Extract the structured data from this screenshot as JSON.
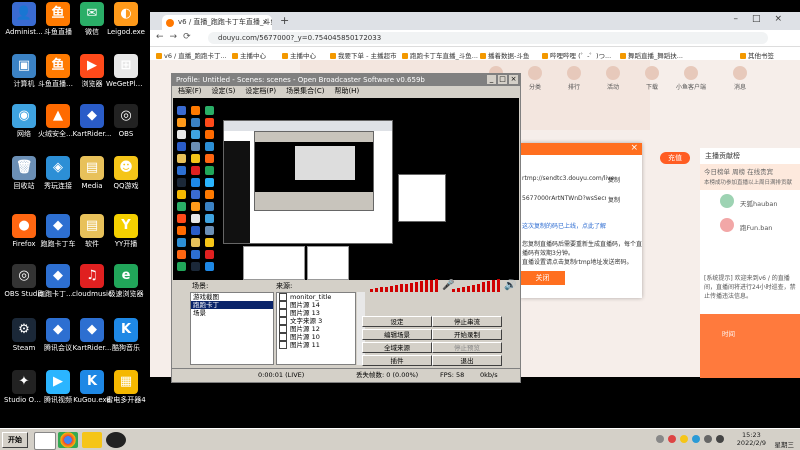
{
  "desktop": {
    "icons": [
      {
        "label": "Administ...",
        "color": "#3a6bd1",
        "glyph": "👤"
      },
      {
        "label": "斗鱼直播",
        "color": "#ff7a00",
        "glyph": "鱼"
      },
      {
        "label": "微信",
        "color": "#2aae67",
        "glyph": "✉"
      },
      {
        "label": "Leigod.exe",
        "color": "#ff9a1a",
        "glyph": "◐"
      },
      {
        "label": "计算机",
        "color": "#3b82c4",
        "glyph": "▣"
      },
      {
        "label": "斗鱼直播伴侣",
        "color": "#ff7a00",
        "glyph": "鱼"
      },
      {
        "label": "浏览器",
        "color": "#ff4a1a",
        "glyph": "▶"
      },
      {
        "label": "WeGetPlug...",
        "color": "#e8e8e8",
        "glyph": "⊞"
      },
      {
        "label": "网络",
        "color": "#3fa3e0",
        "glyph": "◉"
      },
      {
        "label": "火绒安全软件",
        "color": "#ff6a00",
        "glyph": "▲"
      },
      {
        "label": "KartRider...",
        "color": "#2a5cc8",
        "glyph": "◆"
      },
      {
        "label": "OBS",
        "color": "#222222",
        "glyph": "◎"
      },
      {
        "label": "回收站",
        "color": "#6b8fb5",
        "glyph": "🗑"
      },
      {
        "label": "秀玩连接",
        "color": "#2c8fd6",
        "glyph": "◈"
      },
      {
        "label": "Media",
        "color": "#e8c15a",
        "glyph": "▤"
      },
      {
        "label": "QQ游戏",
        "color": "#f5c518",
        "glyph": "☻"
      },
      {
        "label": "Firefox",
        "color": "#ff6611",
        "glyph": "●"
      },
      {
        "label": "跑跑卡丁车",
        "color": "#2d6fd1",
        "glyph": "◆"
      },
      {
        "label": "软件",
        "color": "#e8c15a",
        "glyph": "▤"
      },
      {
        "label": "YY开播",
        "color": "#f5d000",
        "glyph": "Y"
      },
      {
        "label": "OBS Studio",
        "color": "#333333",
        "glyph": "◎"
      },
      {
        "label": "跑跑卡丁车插件",
        "color": "#2d6fd1",
        "glyph": "◆"
      },
      {
        "label": "cloudmusic",
        "color": "#e02020",
        "glyph": "♫"
      },
      {
        "label": "极速浏览器",
        "color": "#21a65a",
        "glyph": "e"
      },
      {
        "label": "Steam",
        "color": "#1b2838",
        "glyph": "⚙"
      },
      {
        "label": "腾讯会议",
        "color": "#2d6fd1",
        "glyph": "◆"
      },
      {
        "label": "KartRider...",
        "color": "#2d6fd1",
        "glyph": "◆"
      },
      {
        "label": "酷狗音乐",
        "color": "#1e88e5",
        "glyph": "K"
      },
      {
        "label": "Studio One 3",
        "color": "#222222",
        "glyph": "✦"
      },
      {
        "label": "腾讯视频",
        "color": "#2bb5ff",
        "glyph": "▶"
      },
      {
        "label": "KuGou.exe",
        "color": "#1e88e5",
        "glyph": "K"
      },
      {
        "label": "雷电多开器4",
        "color": "#f5b800",
        "glyph": "▦"
      }
    ]
  },
  "browser": {
    "tab_title": "v6 / 直播_跑跑卡丁车直播_斗鱼直播",
    "url": "douyu.com/5677000?_y=0.754045850172033",
    "bookmarks": [
      "v6 / 直播_跑跑卡丁...",
      "主播中心",
      "主播中心",
      "我要下单 - 主播超市",
      "跑跑卡丁车直播_斗鱼...",
      "播着数据-斗鱼",
      "哔哩哔哩 (゜-゜)つ...",
      "舞蹈直播_舞蹈扶...",
      "其他书签"
    ],
    "nav_items": [
      "鱼吧",
      "分类",
      "排行",
      "活动",
      "下载",
      "小鱼客户端",
      "消息"
    ],
    "red_button": "充值",
    "dialog": {
      "lines": [
        "rtmp://sendtc3.douyu.com/live",
        "5677000rArtNTWnD?wsSecret=********",
        "这次复制的码已上线，点此了解",
        "您复制直播码后需要重新生成直播码，每个直",
        "播码有效期3分钟。",
        "直播设置请点击复制rtmp地址发送密码。"
      ],
      "copy_label": "复制",
      "close_label": "关闭"
    },
    "side_panel": {
      "header": "主播贡献榜",
      "tabs_text": "今日榜单   周榜   在线贵宾",
      "banner": "本榜成功参加直播以上周日满排贡献",
      "users": [
        "天狐hauban",
        "跑Fun.ban"
      ],
      "notice": "[系统提示] 欢迎来到v6 / 的直播间，直播间将进行24小时巡查，禁止传播违法信息。",
      "promo_text": "时间"
    }
  },
  "obs": {
    "title": "Profile: Untitled - Scenes: scenes - Open Broadcaster Software v0.659b",
    "menu": [
      "档案(F)",
      "设定(S)",
      "设定档(P)",
      "场景集合(C)",
      "帮助(H)"
    ],
    "scenes_label": "场景:",
    "sources_label": "来源:",
    "scenes": [
      "游戏截图",
      "跑跑卡丁",
      "场景"
    ],
    "sources": [
      "monitor_title",
      "图片源 14",
      "图片源 13",
      "文字来源 3",
      "图片源 12",
      "图片源 10",
      "图片源 11"
    ],
    "buttons": {
      "settings": "设定",
      "stop_stream": "停止串流",
      "edit_scene": "编辑场景",
      "start_record": "开始录制",
      "global_sources": "全域来源",
      "preview_stop": "停止预览",
      "plugins": "插件",
      "exit": "退出"
    },
    "status": {
      "time": "0:00:01 (LIVE)",
      "dropped": "丢失帧数: 0 (0.00%)",
      "fps": "FPS: 58",
      "kbps": "0kb/s"
    }
  },
  "taskbar": {
    "start_label": "开始",
    "time": "15:23",
    "date": "2022/2/9",
    "weekday": "星期三"
  }
}
